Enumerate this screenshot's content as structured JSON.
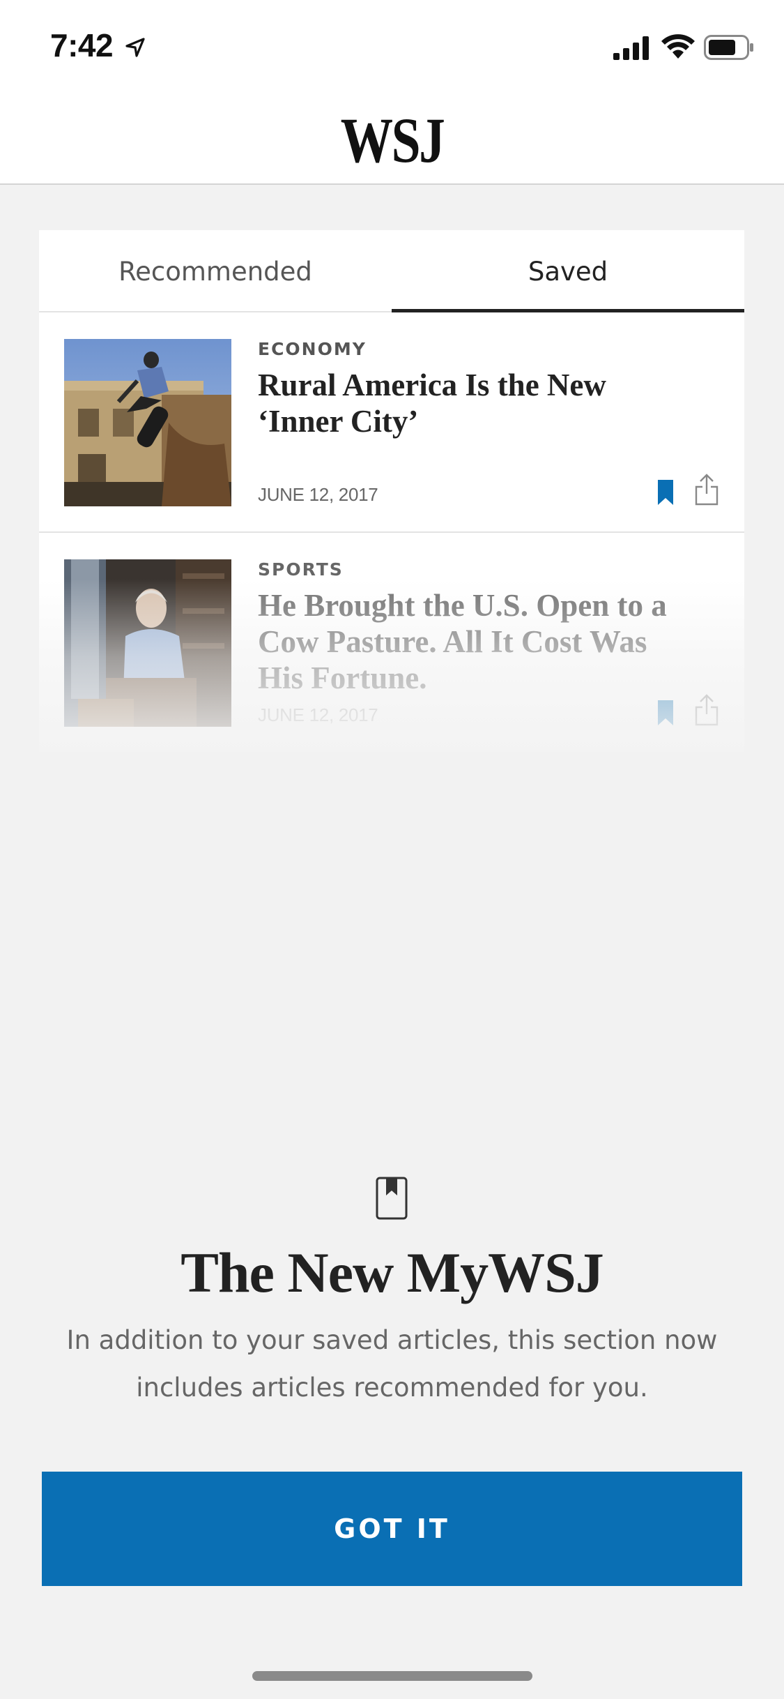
{
  "status_bar": {
    "time": "7:42",
    "icons": [
      "location-arrow-icon",
      "cellular-signal-icon",
      "wifi-icon",
      "battery-icon"
    ]
  },
  "header": {
    "logo": "WSJ"
  },
  "tabs": [
    {
      "label": "Recommended",
      "selected": false
    },
    {
      "label": "Saved",
      "selected": true
    }
  ],
  "articles": [
    {
      "kicker": "ECONOMY",
      "headline": "Rural America Is the New ‘Inner City’",
      "date": "JUNE 12, 2017",
      "saved": true
    },
    {
      "kicker": "SPORTS",
      "headline": "He Brought the U.S. Open to a Cow Pasture. All It Cost Was His Fortune.",
      "date": "JUNE 12, 2017",
      "saved": true
    }
  ],
  "promo": {
    "icon": "bookmark-book-icon",
    "title": "The New MyWSJ",
    "body": "In addition to your saved articles, this section now includes articles recommended for you.",
    "button_label": "GOT IT"
  },
  "colors": {
    "accent": "#0a6fb4",
    "background": "#f2f2f2",
    "text": "#222222"
  }
}
